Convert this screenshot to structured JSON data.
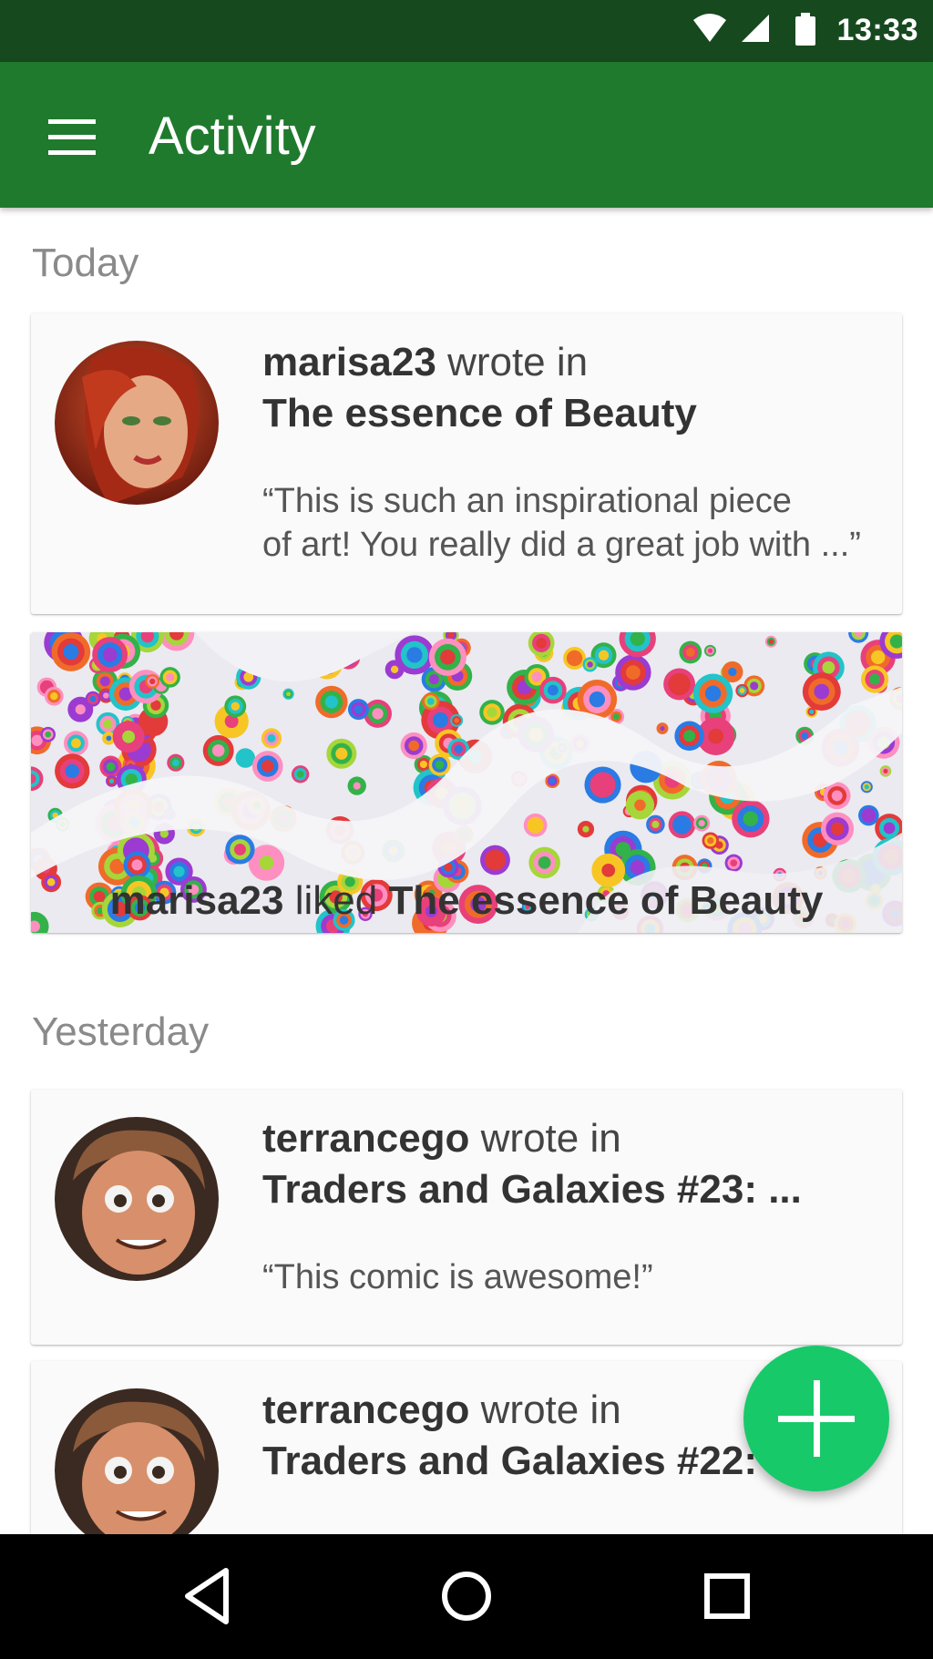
{
  "status_bar": {
    "time": "13:33",
    "background": "#17491f"
  },
  "app_bar": {
    "title": "Activity",
    "background": "#1f7a2d",
    "menu_icon": "hamburger-menu-icon"
  },
  "sections": {
    "today": "Today",
    "yesterday": "Yesterday"
  },
  "activity": [
    {
      "user": "marisa23",
      "verb": "wrote in",
      "title": "The essence of Beauty",
      "quote_line1": "“This is such an inspirational piece",
      "quote_line2": "of art! You really did a great job with ...”"
    },
    {
      "user": "marisa23",
      "verb": "liked",
      "title": "The essence of Beauty"
    },
    {
      "user": "terrancego",
      "verb": "wrote in",
      "title": "Traders and Galaxies #23: ...",
      "quote_line1": "“This comic is awesome!”"
    },
    {
      "user": "terrancego",
      "verb": "wrote in",
      "title": "Traders and Galaxies #22: ..."
    }
  ],
  "fab": {
    "icon": "plus-icon",
    "color": "#18c96a"
  },
  "nav": {
    "back_icon": "back-triangle-icon",
    "home_icon": "home-circle-icon",
    "recents_icon": "recents-square-icon"
  }
}
